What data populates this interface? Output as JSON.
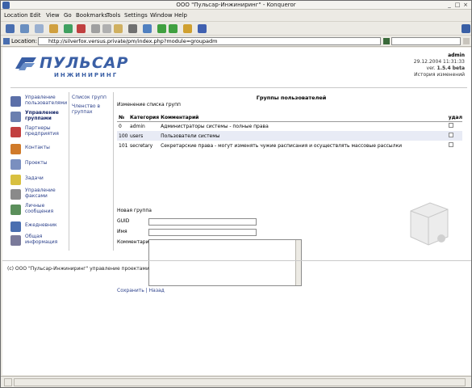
{
  "window": {
    "title": "ООО \"Пульсар-Инжиниринг\" - Konqueror"
  },
  "menubar": [
    "Location",
    "Edit",
    "View",
    "Go",
    "Bookmarks",
    "Tools",
    "Settings",
    "Window",
    "Help"
  ],
  "location": {
    "label": "Location:",
    "url": "http://silverfox.versus.private/pm/index.php?module=groupadm"
  },
  "logo": {
    "word1": "ПУЛЬСАР",
    "word2": "ИНЖИНИРИНГ"
  },
  "userbox": {
    "user": "admin",
    "datetime": "29.12.2004 11:31:33",
    "version_label": "ver.",
    "version": "1.5.4 beta",
    "history_link": "История изменений"
  },
  "sidebar": [
    {
      "label": "Управление пользователями",
      "icon": "users-admin-icon",
      "color": "#5b6fa8"
    },
    {
      "label": "Управление группами",
      "icon": "groups-admin-icon",
      "color": "#6b7fb0",
      "active": true
    },
    {
      "label": "Партнеры предприятия",
      "icon": "partners-icon",
      "color": "#c24040"
    },
    {
      "label": "Контакты",
      "icon": "contacts-icon",
      "color": "#d07a2a"
    },
    {
      "label": "Проекты",
      "icon": "projects-icon",
      "color": "#7a8fbf"
    },
    {
      "label": "Задачи",
      "icon": "tasks-icon",
      "color": "#d8c040"
    },
    {
      "label": "Управление факсами",
      "icon": "fax-icon",
      "color": "#8a8a8a"
    },
    {
      "label": "Личные сообщения",
      "icon": "messages-icon",
      "color": "#5b8f5b"
    },
    {
      "label": "Ежедневник",
      "icon": "calendar-icon",
      "color": "#4a6fb0"
    },
    {
      "label": "Общая информация",
      "icon": "info-icon",
      "color": "#7a7a9a"
    }
  ],
  "submenu": {
    "list_link": "Список групп",
    "membership_link": "Членство в группах"
  },
  "main": {
    "title": "Группы пользователей",
    "subtitle": "Изменение списка групп",
    "columns": [
      "№",
      "Категория",
      "Комментарий",
      "удал"
    ],
    "rows": [
      {
        "id": "0",
        "category": "admin",
        "comment": "Администраторы системы - полные права"
      },
      {
        "id": "100",
        "category": "users",
        "comment": "Пользователи системы"
      },
      {
        "id": "101",
        "category": "secretary",
        "comment": "Секретарские права - могут изменять чужие расписания и осуществлять массовые рассылки"
      }
    ],
    "form": {
      "title": "Новая группа",
      "gid_label": "GUID",
      "name_label": "Имя",
      "comment_label": "Комментарий",
      "save_link": "Сохранить",
      "separator": "|",
      "back_link": "Назад"
    }
  },
  "footer": "(c) ООО \"Пульсар-Инжиниринг\" управление проектами"
}
